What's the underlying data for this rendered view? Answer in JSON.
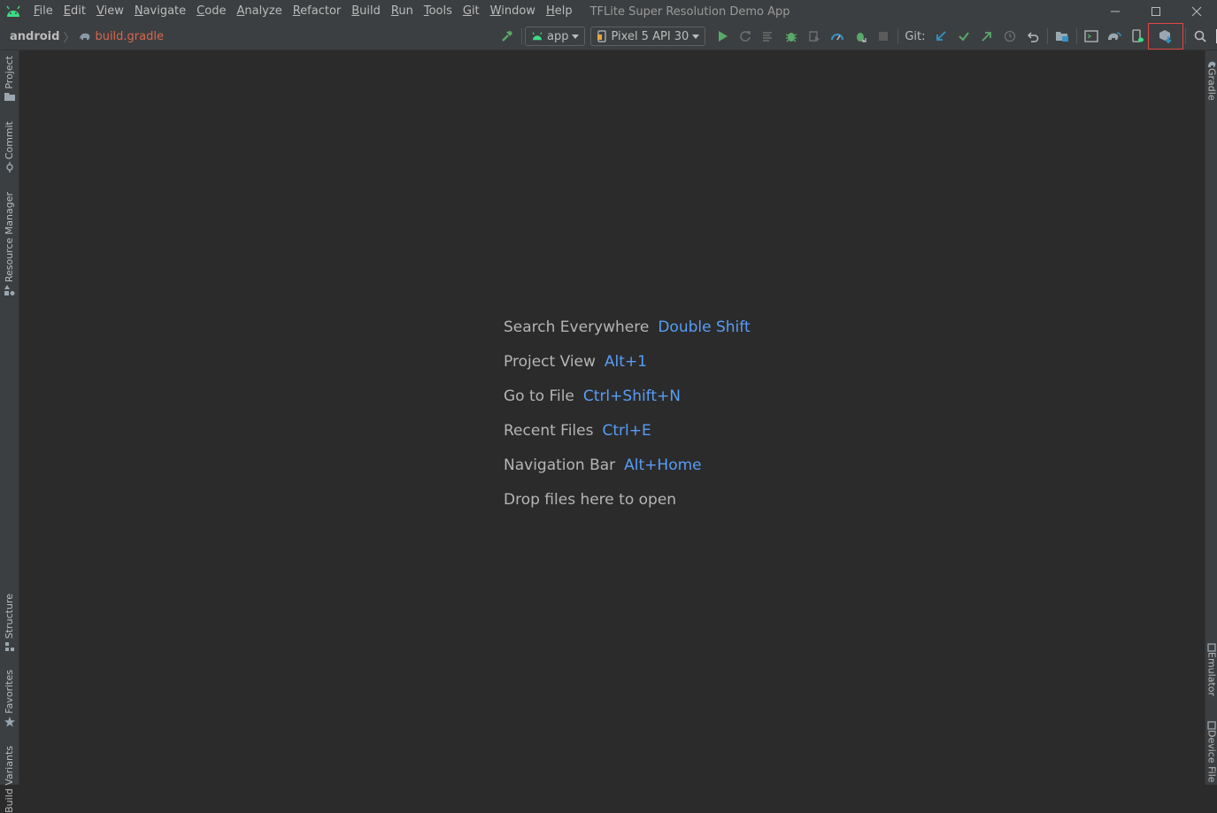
{
  "window": {
    "title": "TFLite Super Resolution Demo App"
  },
  "menu": [
    "File",
    "Edit",
    "View",
    "Navigate",
    "Code",
    "Analyze",
    "Refactor",
    "Build",
    "Run",
    "Tools",
    "Git",
    "Window",
    "Help"
  ],
  "breadcrumb": {
    "root": "android",
    "file": "build.gradle"
  },
  "toolbar": {
    "run_config": "app",
    "device": "Pixel 5 API 30",
    "git_label": "Git:"
  },
  "left_stripe": [
    "Project",
    "Commit",
    "Resource Manager",
    "Structure",
    "Favorites",
    "Build Variants"
  ],
  "right_stripe": [
    "Gradle",
    "Emulator",
    "Device File Explorer"
  ],
  "editor_hints": [
    {
      "label": "Search Everywhere",
      "key": "Double Shift"
    },
    {
      "label": "Project View",
      "key": "Alt+1"
    },
    {
      "label": "Go to File",
      "key": "Ctrl+Shift+N"
    },
    {
      "label": "Recent Files",
      "key": "Ctrl+E"
    },
    {
      "label": "Navigation Bar",
      "key": "Alt+Home"
    },
    {
      "label": "Drop files here to open",
      "key": ""
    }
  ],
  "colors": {
    "background": "#2b2b2b",
    "chrome": "#3c3f41",
    "shortcut_blue": "#589df6",
    "file_red": "#d8664f",
    "android_green": "#3ddc84",
    "highlight_red": "#e04747"
  }
}
